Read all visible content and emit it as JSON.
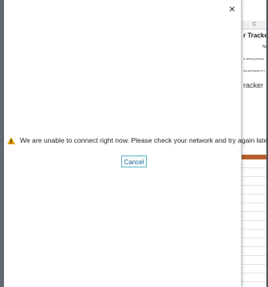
{
  "dialog": {
    "close_glyph": "×",
    "message": "We are unable to connect right now. Please check your network and try again later.",
    "cancel_label": "Cancel",
    "warning_icon": "warning-icon",
    "warning_color": "#e8a000"
  },
  "background_sheet": {
    "column_label": "C",
    "title_fragment": "r Tracke",
    "n_fragment": "Na",
    "small_text_1": "e blood pressu",
    "small_text_2": "od-pressure il o",
    "tracker_fragment": "racker",
    "header_band_color": "#b7602f"
  }
}
